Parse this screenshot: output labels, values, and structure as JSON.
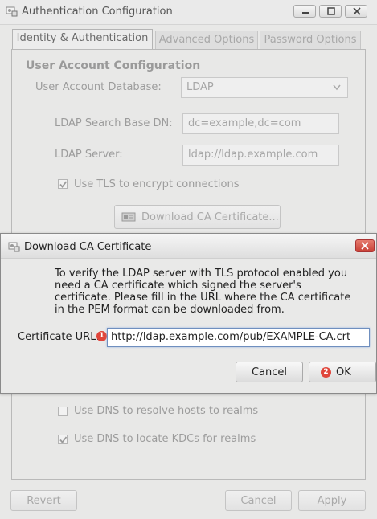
{
  "window": {
    "title": "Authentication Configuration",
    "minimize_icon": "minimize-icon",
    "maximize_icon": "maximize-icon",
    "close_icon": "close-icon"
  },
  "tabs": [
    {
      "label": "Identity & Authentication",
      "active": true
    },
    {
      "label": "Advanced Options",
      "active": false
    },
    {
      "label": "Password Options",
      "active": false
    }
  ],
  "identity": {
    "section_title": "User Account Configuration",
    "database_label": "User Account Database:",
    "database_value": "LDAP",
    "base_dn_label": "LDAP Search Base DN:",
    "base_dn_value": "dc=example,dc=com",
    "server_label": "LDAP Server:",
    "server_value": "ldap://ldap.example.com",
    "tls_label": "Use TLS to encrypt connections",
    "tls_checked": true,
    "download_ca_label": "Download CA Certificate...",
    "dns_hosts_label": "Use DNS to resolve hosts to realms",
    "dns_hosts_checked": false,
    "dns_kdc_label": "Use DNS to locate KDCs for realms",
    "dns_kdc_checked": true
  },
  "footer": {
    "revert_label": "Revert",
    "cancel_label": "Cancel",
    "apply_label": "Apply"
  },
  "dialog": {
    "title": "Download CA Certificate",
    "message": "To verify the LDAP server with TLS protocol enabled you need a CA certificate which signed the server's certificate. Please fill in the URL where the CA certificate in the PEM format can be downloaded from.",
    "url_label": "Certificate URL:",
    "url_value": "http://ldap.example.com/pub/EXAMPLE-CA.crt",
    "cancel_label": "Cancel",
    "ok_label": "OK",
    "badge_1": "1",
    "badge_2": "2"
  },
  "colors": {
    "badge": "#e0453a",
    "focus_border": "#6f8fbf"
  }
}
